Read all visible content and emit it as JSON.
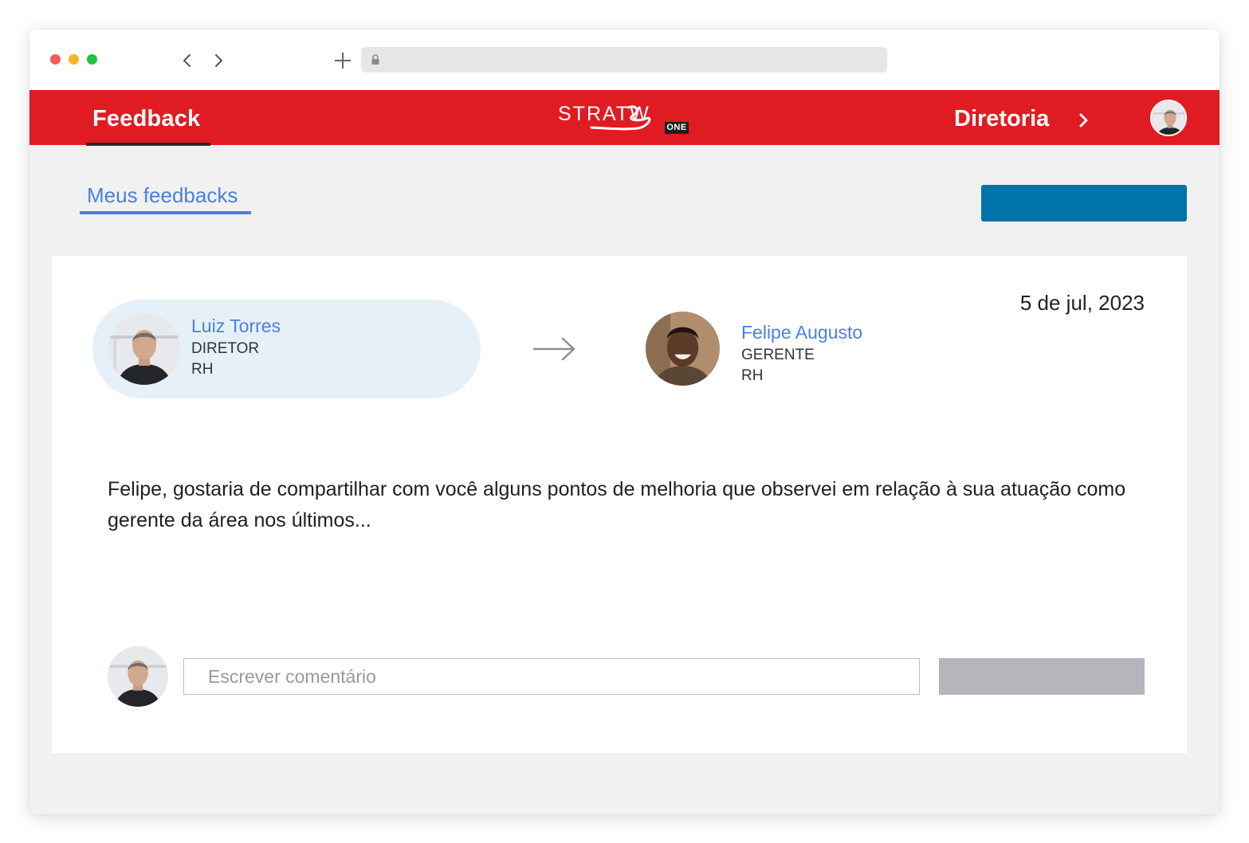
{
  "browser": {
    "url": ""
  },
  "header": {
    "app_title": "Feedback",
    "logo_text": "STRATW",
    "logo_badge": "ONE",
    "department": "Diretoria",
    "colors": {
      "bar": "#e11b22",
      "text": "#ffffff"
    }
  },
  "subnav": {
    "tab_label": "Meus feedbacks",
    "primary_button_label": ""
  },
  "feedback": {
    "date": "5 de jul, 2023",
    "from": {
      "name": "Luiz Torres",
      "role": "DIRETOR",
      "department": "RH"
    },
    "to": {
      "name": "Felipe Augusto",
      "role": "GERENTE",
      "department": "RH"
    },
    "message": "Felipe, gostaria de compartilhar com você alguns pontos de melhoria que observei em relação à sua atuação como gerente da área nos últimos..."
  },
  "comment": {
    "placeholder": "Escrever comentário",
    "value": "",
    "submit_label": ""
  },
  "icons": {
    "back": "chevron-left-icon",
    "forward": "chevron-right-icon",
    "new_tab": "plus-icon",
    "lock": "lock-icon",
    "dept_next": "chevron-right-icon",
    "direction": "arrow-right-icon"
  },
  "colors": {
    "accent_blue": "#4a80e0",
    "primary_button": "#0073a8",
    "disabled_button": "#b5b6bc"
  }
}
